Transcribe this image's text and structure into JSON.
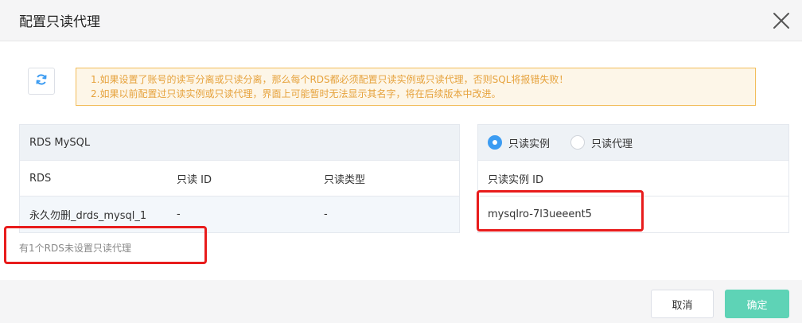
{
  "dialog": {
    "title": "配置只读代理"
  },
  "notice": {
    "line1": "1.如果设置了账号的读写分离或只读分离，那么每个RDS都必须配置只读实例或只读代理，否则SQL将报错失败！",
    "line2": "2.如果以前配置过只读实例或只读代理，界面上可能暂时无法显示其名字，将在后续版本中改进。"
  },
  "left_panel": {
    "title": "RDS MySQL",
    "columns": [
      "RDS",
      "只读 ID",
      "只读类型"
    ],
    "rows": [
      [
        "永久勿删_drds_mysql_1",
        "-",
        "-"
      ]
    ],
    "summary": "有1个RDS未设置只读代理"
  },
  "right_panel": {
    "options": [
      {
        "label": "只读实例",
        "selected": true
      },
      {
        "label": "只读代理",
        "selected": false
      }
    ],
    "column": "只读实例 ID",
    "value": "mysqlro-7l3ueeent5"
  },
  "footer": {
    "cancel": "取消",
    "ok": "确定"
  },
  "colors": {
    "accent": "#3c9cf2",
    "ok": "#5ed3b6",
    "warning_border": "#f2bd5a",
    "highlight": "#e81c1c"
  }
}
